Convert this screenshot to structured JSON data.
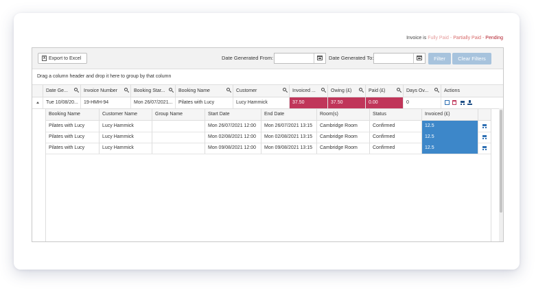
{
  "legend": {
    "prefix": "Invoice is",
    "fully_paid": "Fully Paid",
    "sep1": "-",
    "partially_paid": "Partially Paid",
    "sep2": "-",
    "pending": "Pending"
  },
  "toolbar": {
    "export_label": "Export to Excel",
    "date_from_label": "Date Generated From:",
    "date_from_value": "",
    "date_to_label": "Date Generated To:",
    "date_to_value": "",
    "filter_label": "Filter",
    "clear_filters_label": "Clear Filters"
  },
  "group_hint": "Drag a column header and drop it here to group by that column",
  "master_columns": [
    "Date Ge...",
    "Invoice Number",
    "Booking Star...",
    "Booking Name",
    "Customer",
    "Invoiced ...",
    "Owing (£)",
    "Paid (£)",
    "Days Ov...",
    "Actions"
  ],
  "master_row": {
    "date": "Tue 10/08/20...",
    "invoice_number": "19-HMH-94",
    "booking_start": "Mon 26/07/2021...",
    "booking_name": "Pilates with Lucy",
    "customer": "Lucy Hammick",
    "invoiced": "37.50",
    "owing": "37.50",
    "paid": "0.00",
    "days_overdue": "0"
  },
  "detail_columns": [
    "Booking Name",
    "Customer Name",
    "Group Name",
    "Start Date",
    "End Date",
    "Room(s)",
    "Status",
    "Invoiced (£)",
    ""
  ],
  "detail_rows": [
    {
      "booking_name": "Pilates with Lucy",
      "customer_name": "Lucy Hammick",
      "group_name": "",
      "start": "Mon 26/07/2021 12:00",
      "end": "Mon 26/07/2021 13:15",
      "room": "Cambridge Room",
      "status": "Confirmed",
      "invoiced": "12.5"
    },
    {
      "booking_name": "Pilates with Lucy",
      "customer_name": "Lucy Hammick",
      "group_name": "",
      "start": "Mon 02/08/2021 12:00",
      "end": "Mon 02/08/2021 13:15",
      "room": "Cambridge Room",
      "status": "Confirmed",
      "invoiced": "12.5"
    },
    {
      "booking_name": "Pilates with Lucy",
      "customer_name": "Lucy Hammick",
      "group_name": "",
      "start": "Mon 09/08/2021 12:00",
      "end": "Mon 09/08/2021 13:15",
      "room": "Cambridge Room",
      "status": "Confirmed",
      "invoiced": "12.5"
    }
  ],
  "colors": {
    "pending": "#c0365a",
    "invoiced_cell": "#3d87c9",
    "filter_button": "#a7c3dd"
  },
  "icons": [
    "excel-icon",
    "calendar-icon",
    "search-icon",
    "expand-icon",
    "edit-icon",
    "delete-icon",
    "cart-icon",
    "download-icon"
  ]
}
